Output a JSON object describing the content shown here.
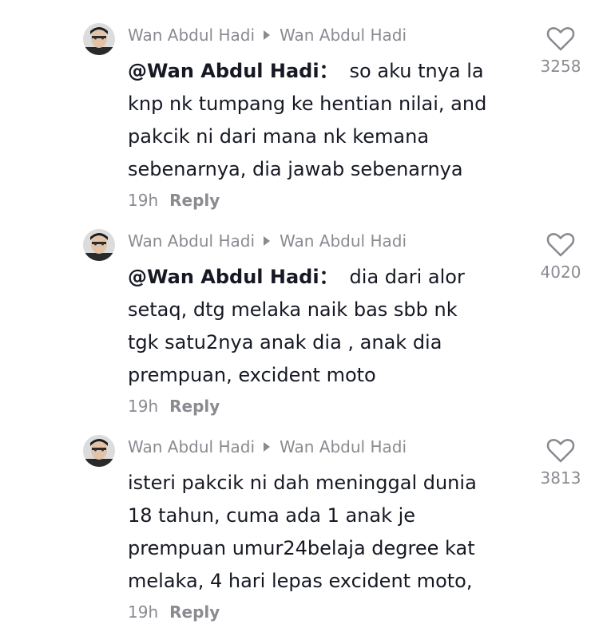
{
  "comments": [
    {
      "author": "Wan Abdul Hadi",
      "reply_to": "Wan Abdul Hadi",
      "mention": "@Wan Abdul Hadi",
      "mention_sep": "：",
      "lines": [
        "so aku tnya la",
        "knp nk tumpang ke hentian nilai, and",
        "pakcik ni dari mana nk kemana",
        "sebenarnya, dia jawab sebenarnya"
      ],
      "time": "19h",
      "reply_label": "Reply",
      "likes": "3258",
      "icon": "heart-outline-icon"
    },
    {
      "author": "Wan Abdul Hadi",
      "reply_to": "Wan Abdul Hadi",
      "mention": "@Wan Abdul Hadi",
      "mention_sep": "：",
      "lines": [
        "dia dari alor",
        "setaq, dtg melaka naik bas sbb nk",
        "tgk satu2nya anak dia , anak dia",
        "prempuan, excident moto"
      ],
      "time": "19h",
      "reply_label": "Reply",
      "likes": "4020",
      "icon": "heart-outline-icon"
    },
    {
      "author": "Wan Abdul Hadi",
      "reply_to": "Wan Abdul Hadi",
      "mention": "",
      "mention_sep": "",
      "lines": [
        "isteri pakcik ni dah meninggal dunia",
        "18 tahun, cuma ada 1 anak je",
        "prempuan umur24belaja degree kat",
        "melaka, 4 hari lepas excident moto,"
      ],
      "time": "19h",
      "reply_label": "Reply",
      "likes": "3813",
      "icon": "heart-outline-icon"
    }
  ]
}
